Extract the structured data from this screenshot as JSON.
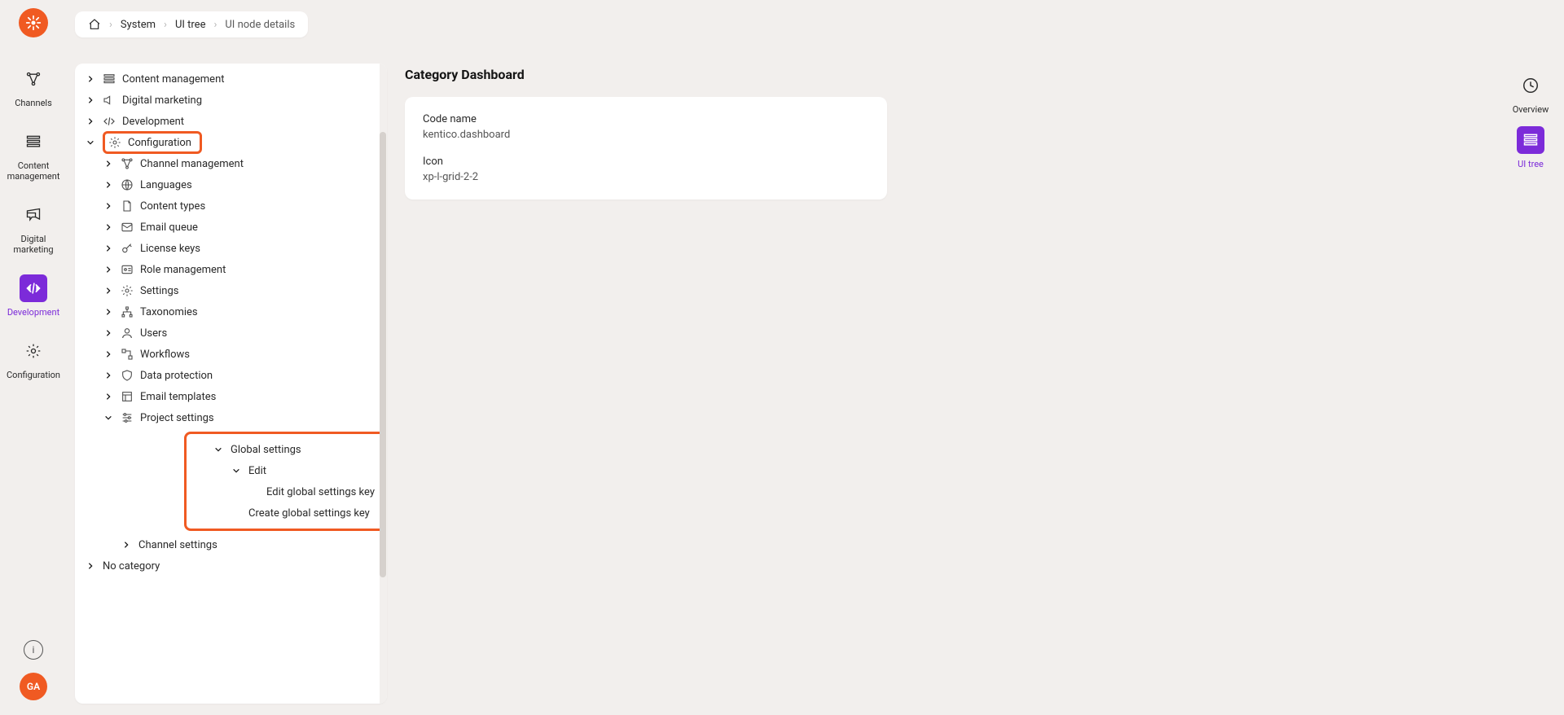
{
  "breadcrumb": {
    "items": [
      "System",
      "UI tree",
      "UI node details"
    ]
  },
  "leftNav": {
    "channels": "Channels",
    "contentManagement": "Content management",
    "digitalMarketing": "Digital marketing",
    "development": "Development",
    "configuration": "Configuration"
  },
  "avatar": "GA",
  "rightNav": {
    "overview": "Overview",
    "uitree": "UI tree"
  },
  "pageTitle": "Category Dashboard",
  "card": {
    "codeNameLabel": "Code name",
    "codeNameValue": "kentico.dashboard",
    "iconLabel": "Icon",
    "iconValue": "xp-l-grid-2-2"
  },
  "tree": {
    "contentManagement": "Content management",
    "digitalMarketing": "Digital marketing",
    "development": "Development",
    "configuration": "Configuration",
    "channelManagement": "Channel management",
    "languages": "Languages",
    "contentTypes": "Content types",
    "emailQueue": "Email queue",
    "licenseKeys": "License keys",
    "roleManagement": "Role management",
    "settings": "Settings",
    "taxonomies": "Taxonomies",
    "users": "Users",
    "workflows": "Workflows",
    "dataProtection": "Data protection",
    "emailTemplates": "Email templates",
    "projectSettings": "Project settings",
    "globalSettings": "Global settings",
    "edit": "Edit",
    "editGlobalKey": "Edit global settings key",
    "createGlobalKey": "Create global settings key",
    "channelSettings": "Channel settings",
    "noCategory": "No category"
  }
}
